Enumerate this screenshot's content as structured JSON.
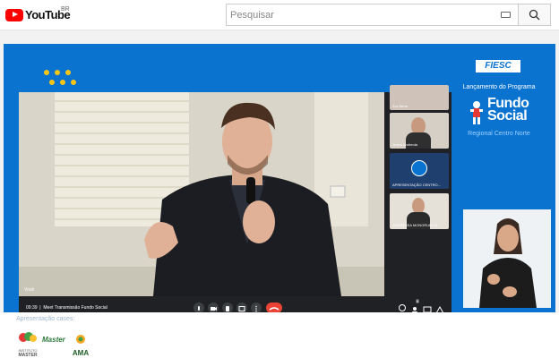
{
  "header": {
    "logo_text": "YouTube",
    "region": "BR",
    "search_placeholder": "Pesquisar"
  },
  "banner": {
    "brand": "FIESC",
    "launch_text": "Lançamento do Programa",
    "program_line1": "Fundo",
    "program_line2": "Social",
    "region_text": "Regional Centro Norte"
  },
  "meet": {
    "main_label": "Você",
    "time": "09:39",
    "meeting_title": "Meet Transmissão Fundo Social",
    "tiles": [
      {
        "label": "Ara Berta"
      },
      {
        "label": "Juana Andreola"
      },
      {
        "label": "APRESENTAÇÃO CENTRO..."
      },
      {
        "label": "ANDRESSA MONGRUEL N..."
      }
    ],
    "participants_count": "8"
  },
  "below": {
    "cases_label": "Apresentação cases:",
    "logo1_line1": "INSTITUTO",
    "logo1_line2": "MASTER",
    "logo2": "Master",
    "logo3": "AMA"
  },
  "colors": {
    "banner_blue": "#0a73cf",
    "meet_bg": "#202124",
    "hangup_red": "#ea4335",
    "yt_red": "#ff0000"
  }
}
